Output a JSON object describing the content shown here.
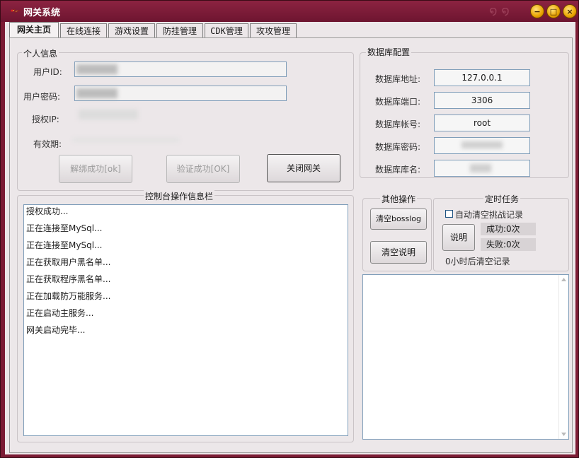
{
  "window": {
    "title": "网关系统",
    "buttons": {
      "minimize": "−",
      "maximize": "□",
      "close": "×"
    }
  },
  "tabs": [
    "网关主页",
    "在线连接",
    "游戏设置",
    "防挂管理",
    "CDK管理",
    "攻攻管理"
  ],
  "personal": {
    "group_label": "个人信息",
    "user_id_label": "用户ID:",
    "user_pwd_label": "用户密码:",
    "auth_ip_label": "授权IP:",
    "validity_label": "有效期:",
    "unbind_button": "解绑成功[ok]",
    "verify_button": "验证成功[OK]",
    "close_gateway_button": "关闭网关"
  },
  "database": {
    "group_label": "数据库配置",
    "address_label": "数据库地址:",
    "address_value": "127.0.0.1",
    "port_label": "数据库端口:",
    "port_value": "3306",
    "account_label": "数据库帐号:",
    "account_value": "root",
    "password_label": "数据库密码:",
    "dbname_label": "数据库库名:"
  },
  "console": {
    "group_label": "控制台操作信息栏",
    "lines": [
      "授权成功...",
      "正在连接至MySql...",
      "正在连接至MySql...",
      "正在获取用户黑名单...",
      "正在获取程序黑名单...",
      "正在加载防万能服务...",
      "正在启动主服务...",
      "网关启动完毕..."
    ]
  },
  "other_ops": {
    "group_label": "其他操作",
    "clear_bosslog_button": "清空bosslog",
    "clear_desc_button": "清空说明"
  },
  "scheduled": {
    "group_label": "定时任务",
    "auto_clear_label": "自动清空挑战记录",
    "auto_clear_checked": false,
    "explain_button": "说明",
    "success_text": "成功:0次",
    "fail_text": "失败:0次",
    "clear_after_text": "0小时后清空记录"
  },
  "icons": [
    "app-icon",
    "minimize-icon",
    "maximize-icon",
    "close-icon",
    "scroll-up-icon",
    "scroll-down-icon",
    "swirl-ornament-icon"
  ],
  "colors": {
    "title_bar": "#7b1b34",
    "panel": "#ece7e9",
    "field_border": "#7f9db9",
    "button_yellow": "#e9a400"
  }
}
